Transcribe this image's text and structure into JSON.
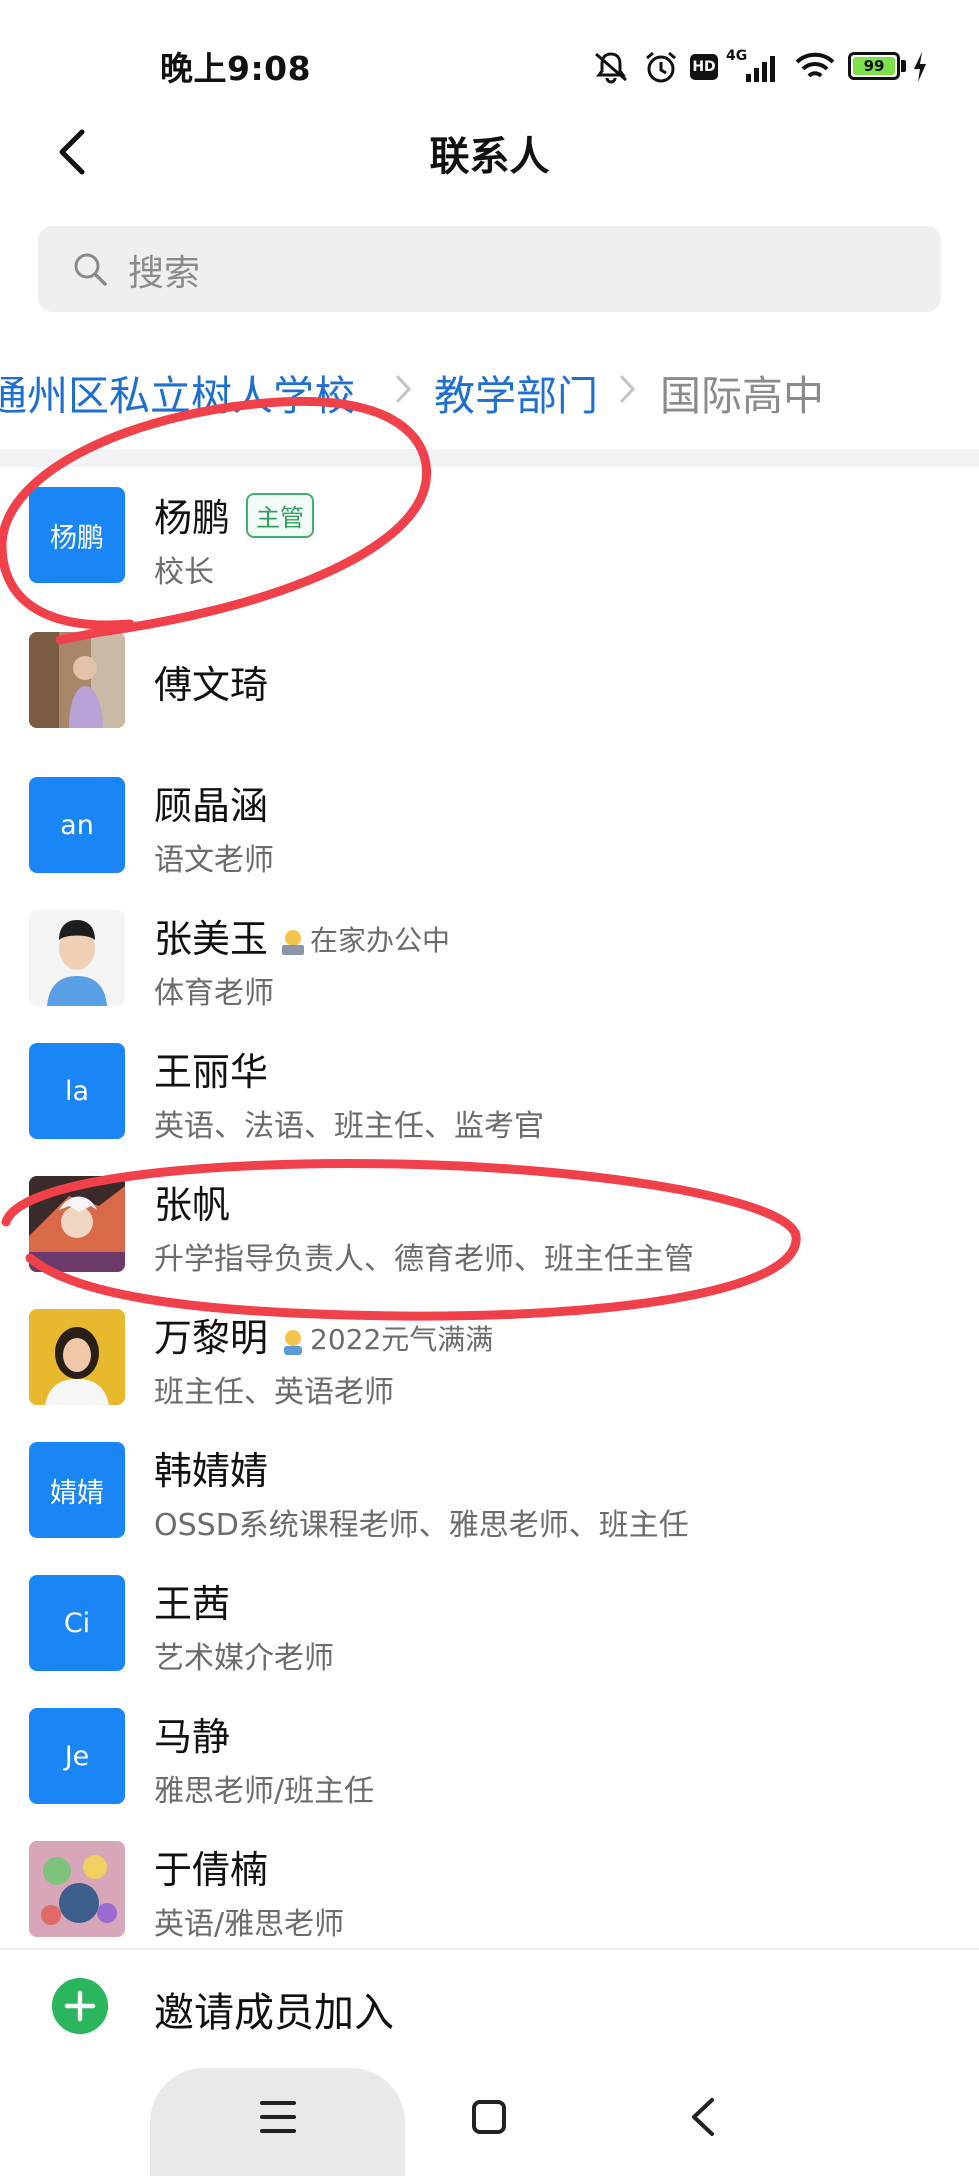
{
  "status_bar": {
    "time": "晚上9:08",
    "icons": [
      "mute-bell-icon",
      "alarm-icon",
      "hd-icon",
      "signal-4g-icon",
      "wifi-icon",
      "battery-icon",
      "charging-icon"
    ],
    "network_label": "4G",
    "hd_label": "HD",
    "battery_level": "99"
  },
  "header": {
    "title": "联系人",
    "back_icon": "chevron-left-icon"
  },
  "search": {
    "placeholder": "搜索"
  },
  "breadcrumb": [
    "通州区私立树人学校",
    "教学部门",
    "国际高中"
  ],
  "contacts": [
    {
      "name": "杨鹏",
      "badge": "主管",
      "role": "校长",
      "avatar_text": "杨鹏"
    },
    {
      "name": "傅文琦",
      "role": ""
    },
    {
      "name": "顾晶涵",
      "role": "语文老师",
      "avatar_text": "an"
    },
    {
      "name": "张美玉",
      "status": "在家办公中",
      "role": "体育老师"
    },
    {
      "name": "王丽华",
      "role": "英语、法语、班主任、监考官",
      "avatar_text": "la"
    },
    {
      "name": "张帆",
      "role": "升学指导负责人、德育老师、班主任主管"
    },
    {
      "name": "万黎明",
      "status": "2022元气满满",
      "role": "班主任、英语老师"
    },
    {
      "name": "韩婧婧",
      "role": "OSSD系统课程老师、雅思老师、班主任",
      "avatar_text": "婧婧"
    },
    {
      "name": "王茜",
      "role": "艺术媒介老师",
      "avatar_text": "Ci"
    },
    {
      "name": "马静",
      "role": "雅思老师/班主任",
      "avatar_text": "Je"
    },
    {
      "name": "于倩楠",
      "role": "英语/雅思老师"
    }
  ],
  "invite": {
    "label": "邀请成员加入"
  },
  "nav_bar": {
    "icons": [
      "menu-icon",
      "home-square-icon",
      "back-triangle-icon"
    ]
  },
  "colors": {
    "accent": "#1a85f5",
    "breadcrumb": "#1e6fd0",
    "badge_green": "#2f9f5e",
    "annotation_red": "#f0404a"
  }
}
